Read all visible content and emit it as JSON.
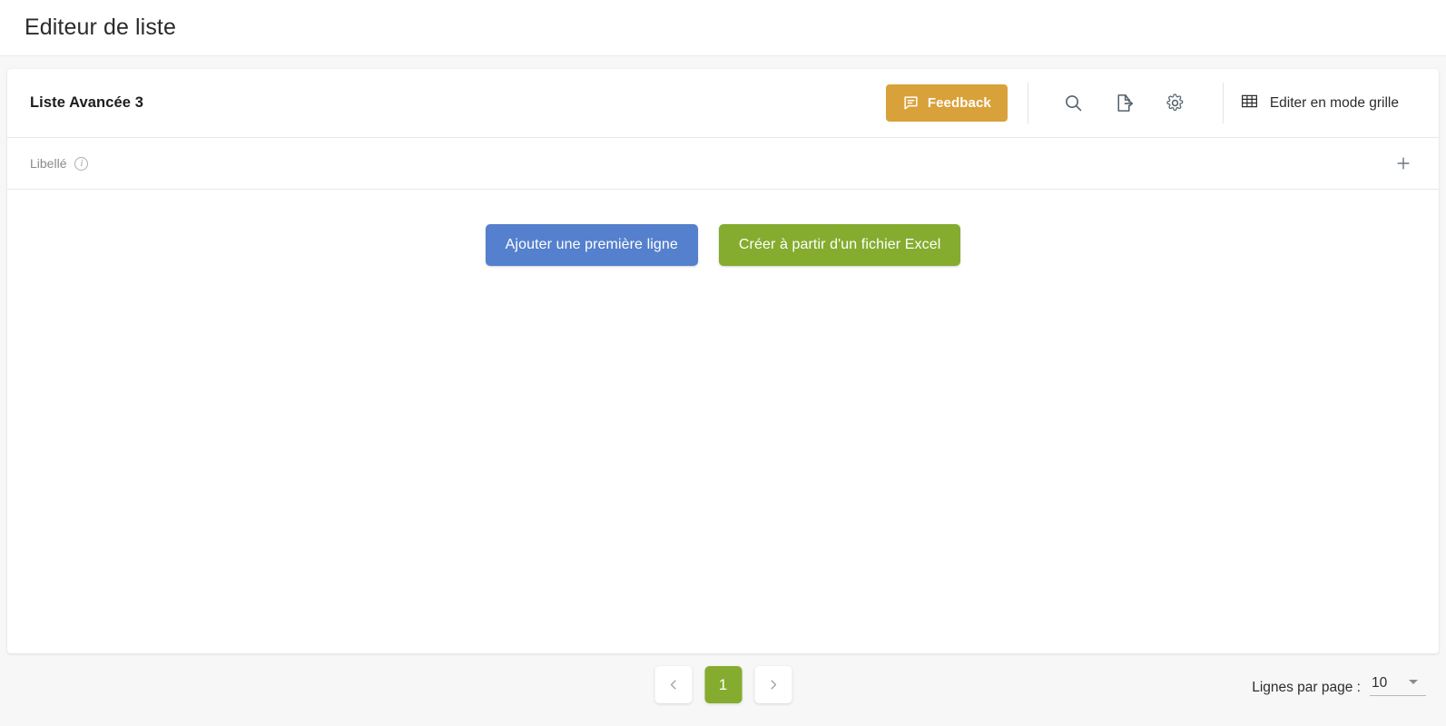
{
  "app": {
    "title": "Editeur de liste"
  },
  "card": {
    "list_title": "Liste Avancée 3",
    "header": {
      "feedback_label": "Feedback",
      "feedback_icon": "comment-icon",
      "feedback_color": "#d9a13a",
      "search_icon": "search-icon",
      "export_icon": "export-file-icon",
      "settings_icon": "gear-icon",
      "grid_mode_label": "Editer en mode grille",
      "grid_mode_icon": "table-grid-icon"
    },
    "columns": [
      {
        "label": "Libellé",
        "info_icon": "info-icon"
      }
    ],
    "add_column_icon": "plus-icon",
    "empty_state": {
      "add_row_label": "Ajouter une première ligne",
      "add_row_color": "#5580cd",
      "excel_label": "Créer à partir d'un fichier Excel",
      "excel_color": "#85ac2e"
    }
  },
  "footer": {
    "pagination": {
      "prev_icon": "chevron-left-icon",
      "next_icon": "chevron-right-icon",
      "current_page": "1",
      "active_color": "#85ac2e"
    },
    "rows_per_page": {
      "label": "Lignes par page :",
      "value": "10",
      "caret_icon": "chevron-down-icon"
    }
  }
}
